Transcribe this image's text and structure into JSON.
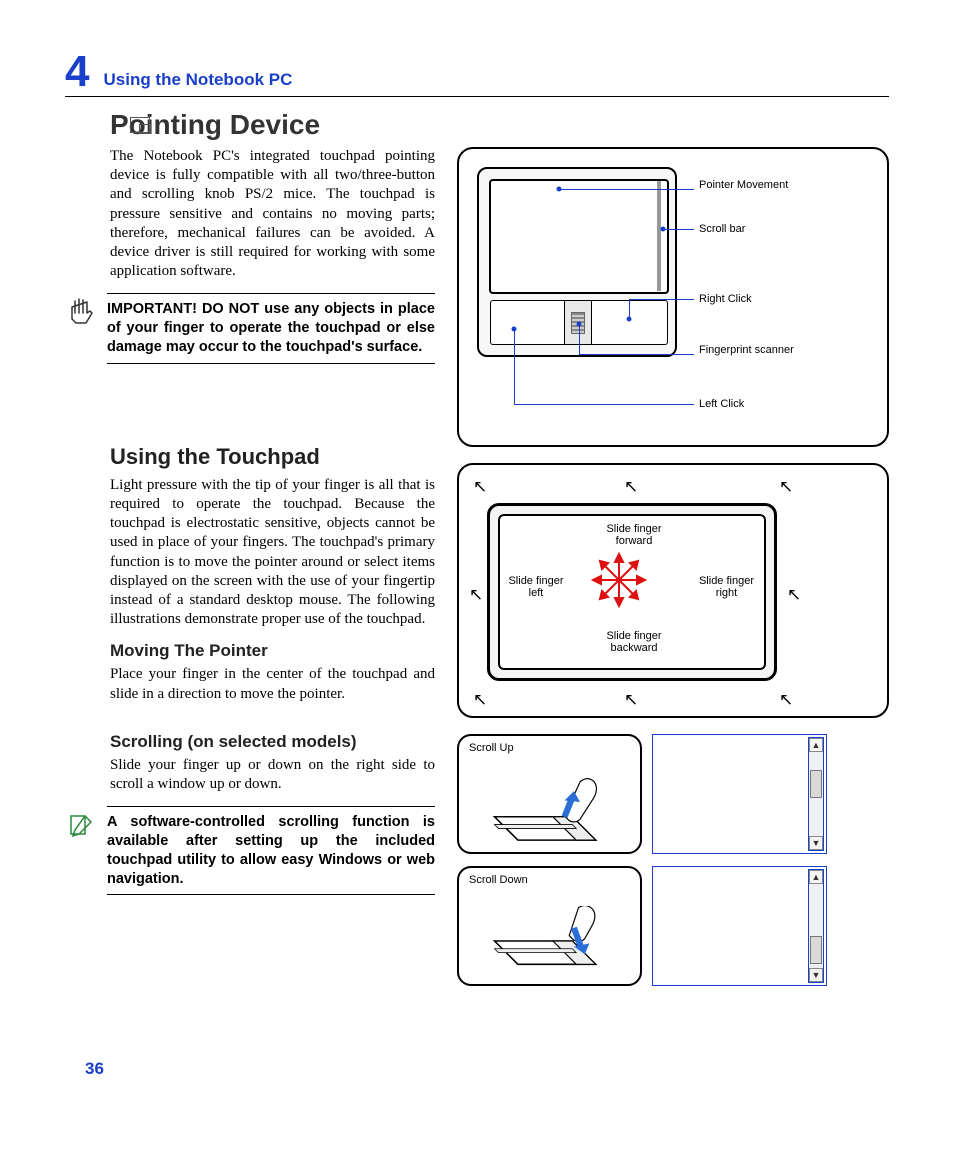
{
  "chapter": {
    "number": "4",
    "title": "Using the Notebook PC"
  },
  "heading": "Pointing Device",
  "intro": "The Notebook PC's integrated touchpad pointing device is fully compatible with all two/three-button and scrolling knob PS/2 mice. The touchpad is pressure sensitive and contains no moving parts; therefore, mechanical failures can be avoided. A device driver is still required for working with some application software.",
  "important": "IMPORTANT! DO NOT use any objects in place of your finger to operate the touchpad or else damage may occur to the touchpad's surface.",
  "using_heading": "Using the Touchpad",
  "using_text": "Light pressure with the tip of your finger is all that is required to operate the touchpad. Because the touchpad is electrostatic sensitive, objects cannot be used in place of your fingers. The touchpad's primary function is to move the pointer around or select items displayed on the screen with the use of your fingertip instead of a standard desktop mouse. The following illustrations demonstrate proper use of the touchpad.",
  "moving_heading": "Moving The Pointer",
  "moving_text": "Place your finger in the center of the touchpad and slide in a direction to move the pointer.",
  "scrolling_heading": "Scrolling (on selected models)",
  "scrolling_text": "Slide your finger up or down on the right side to scroll a window up or down.",
  "note": "A software-controlled scrolling function is available after setting up the included touchpad utility to allow easy Windows or web navigation.",
  "page_number": "36",
  "diagram1_labels": {
    "pointer": "Pointer Movement",
    "scroll": "Scroll bar",
    "right": "Right Click",
    "fp": "Fingerprint scanner",
    "left": "Left Click"
  },
  "diagram2_labels": {
    "forward": "Slide finger forward",
    "backward": "Slide finger backward",
    "left": "Slide finger left",
    "right": "Slide finger right"
  },
  "scroll_labels": {
    "up": "Scroll Up",
    "down": "Scroll Down"
  }
}
